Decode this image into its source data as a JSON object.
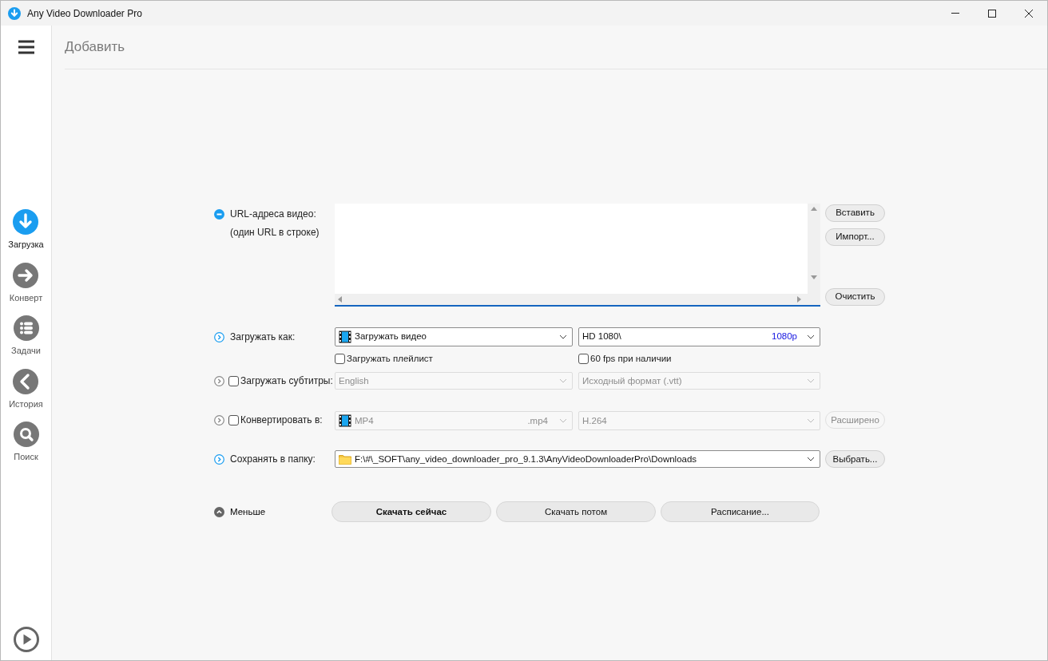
{
  "window": {
    "title": "Any Video Downloader Pro"
  },
  "sidebar": {
    "items": [
      {
        "label": "Загрузка",
        "kind": "download",
        "selected": true
      },
      {
        "label": "Конверт",
        "kind": "convert",
        "selected": false
      },
      {
        "label": "Задачи",
        "kind": "tasks",
        "selected": false
      },
      {
        "label": "История",
        "kind": "history",
        "selected": false
      },
      {
        "label": "Поиск",
        "kind": "search",
        "selected": false
      }
    ]
  },
  "header": {
    "title": "Добавить"
  },
  "url_section": {
    "label": "URL-адреса видео:",
    "hint": "(один URL в строке)",
    "expanded": true,
    "buttons": [
      "Вставить",
      "Импорт...",
      "Очистить"
    ]
  },
  "download_as": {
    "label": "Загружать как:",
    "expanded": false,
    "type": "Загружать видео",
    "quality": "HD 1080\\",
    "resolution": "1080p",
    "options": [
      {
        "label": "Загружать плейлист",
        "checked": false
      },
      {
        "label": "60 fps при наличии",
        "checked": false
      }
    ]
  },
  "subtitles": {
    "label": "Загружать субтитры:",
    "expanded": false,
    "checked": false,
    "language": "English",
    "format": "Исходный формат (.vtt)"
  },
  "convert": {
    "label": "Конвертировать в:",
    "expanded": false,
    "checked": false,
    "format": "MP4",
    "extension": ".mp4",
    "codec": "H.264",
    "advanced_button": "Расширено"
  },
  "save_folder": {
    "label": "Сохранять в папку:",
    "expanded": false,
    "path": "F:\\#\\_SOFT\\any_video_downloader_pro_9.1.3\\AnyVideoDownloaderPro\\Downloads",
    "browse_button": "Выбрать..."
  },
  "footer": {
    "toggle": "Меньше",
    "buttons": [
      {
        "label": "Скачать сейчас",
        "primary": true
      },
      {
        "label": "Скачать потом",
        "primary": false
      },
      {
        "label": "Расписание...",
        "primary": false
      }
    ]
  }
}
